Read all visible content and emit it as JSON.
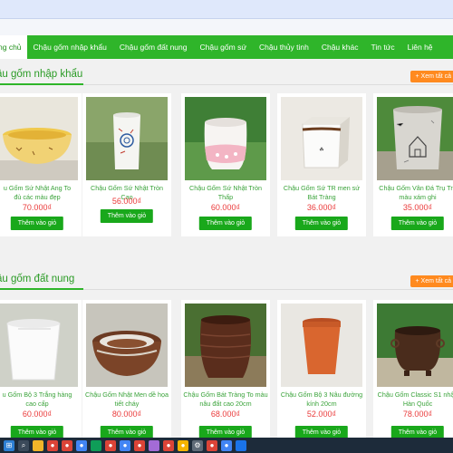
{
  "nav": {
    "items": [
      {
        "label": "ng chủ",
        "active": true
      },
      {
        "label": "Chậu gốm nhập khẩu"
      },
      {
        "label": "Chậu gốm đất nung"
      },
      {
        "label": "Chậu gốm sứ"
      },
      {
        "label": "Chậu thủy tinh"
      },
      {
        "label": "Chậu khác"
      },
      {
        "label": "Tin tức"
      },
      {
        "label": "Liên hệ"
      }
    ]
  },
  "sections": [
    {
      "title": "ậu gốm nhập khẩu",
      "see_all": "+ Xem tất cả",
      "products": [
        {
          "name": "u Gốm Sứ Nhật Ang To\nđủ các màu đẹp",
          "price": "70.000₫",
          "button": "Thêm vào giỏ",
          "icon": "yellow-bowl-pot-icon"
        },
        {
          "name": "Chậu Gốm Sứ Nhật Tròn Cao",
          "price": "56.000₫",
          "button": "Thêm vào giỏ",
          "icon": "white-cylinder-pot-icon"
        },
        {
          "name": "Chậu Gốm Sứ Nhật Tròn\nThấp",
          "price": "60.000₫",
          "button": "Thêm vào giỏ",
          "icon": "pink-dot-pot-icon"
        },
        {
          "name": "Chậu Gốm Sứ TR men sứ\nBát Tràng",
          "price": "36.000₫",
          "button": "Thêm vào giỏ",
          "icon": "square-white-pot-icon"
        },
        {
          "name": "Chậu Gốm Vân Đá Trụ Tro\nmàu xám ghi",
          "price": "35.000₫",
          "button": "Thêm vào giỏ",
          "icon": "grey-stone-pot-icon"
        }
      ]
    },
    {
      "title": "ậu gốm đất nung",
      "see_all": "+ Xem tất cả",
      "products": [
        {
          "name": "u Gốm Bộ 3 Trắng hàng\ncao cấp",
          "price": "60.000₫",
          "button": "Thêm vào giỏ",
          "icon": "white-nested-pots-icon"
        },
        {
          "name": "Chậu Gốm Nhật Men dề họa\ntiết cháy",
          "price": "80.000₫",
          "button": "Thêm vào giỏ",
          "icon": "brown-nested-pots-icon"
        },
        {
          "name": "Chậu Gốm Bát Tràng To màu\nnâu đất cao 20cm",
          "price": "68.000₫",
          "button": "Thêm vào giỏ",
          "icon": "dark-brown-pot-icon"
        },
        {
          "name": "Chậu Gốm Bộ 3 Nâu đường\nkính 20cm",
          "price": "52.000₫",
          "button": "Thêm vào giỏ",
          "icon": "terracotta-pot-icon"
        },
        {
          "name": "Chậu Gốm Classic S1 nhập\nHàn Quốc",
          "price": "78.000₫",
          "button": "Thêm vào giỏ",
          "icon": "classic-footed-pot-icon"
        }
      ]
    }
  ],
  "taskbar": {
    "icons": [
      "windows-start-icon",
      "search-icon",
      "file-explorer-icon",
      "chrome-icon",
      "chrome-icon",
      "chrome-icon",
      "photos-icon",
      "chrome-icon",
      "chrome-icon",
      "chrome-icon",
      "paint-icon",
      "chrome-icon",
      "chrome-icon",
      "settings-icon",
      "chrome-icon",
      "chrome-icon",
      "app-icon"
    ]
  },
  "colors": {
    "brand_green": "#2fb52a",
    "price_red": "#ea3a3a",
    "see_all_orange": "#ff8a1f"
  }
}
